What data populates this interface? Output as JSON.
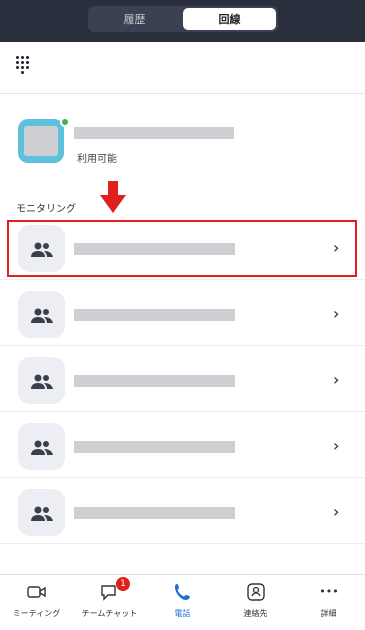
{
  "top": {
    "tab_history": "履歴",
    "tab_line": "回線"
  },
  "self": {
    "status": "利用可能"
  },
  "section": {
    "monitoring_label": "モニタリング"
  },
  "rows": [
    {
      "chevron": "›"
    },
    {
      "chevron": "›"
    },
    {
      "chevron": "›"
    },
    {
      "chevron": "›"
    },
    {
      "chevron": "›"
    }
  ],
  "tabbar": {
    "meeting": "ミーティング",
    "team_chat": "チームチャット",
    "team_chat_badge": "1",
    "phone": "電話",
    "contacts": "連絡先",
    "more": "詳細",
    "more_glyph": "•••"
  },
  "colors": {
    "accent": "#1f6fd1",
    "highlight": "#e0201c",
    "presence": "#3bb54a"
  }
}
